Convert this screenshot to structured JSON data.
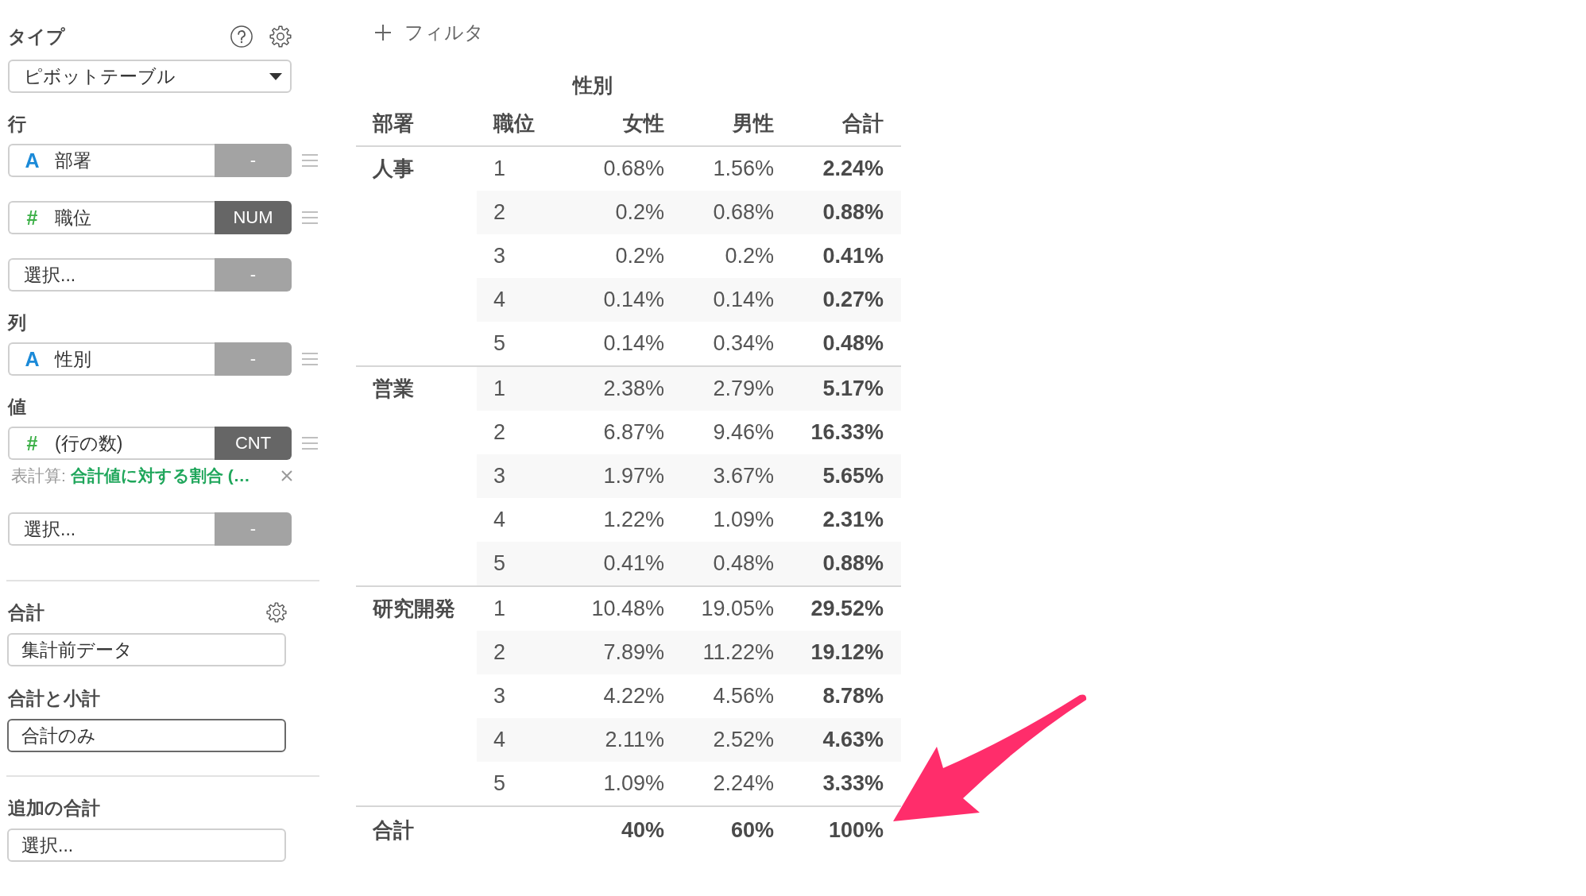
{
  "sidebar": {
    "type": {
      "label": "タイプ",
      "dropdown": {
        "value": "ピボットテーブル"
      }
    },
    "sections": [
      {
        "label": "行",
        "fields": [
          {
            "kind": "string",
            "type_icon": "A",
            "name": "部署",
            "button": {
              "label": "-",
              "active": false
            }
          },
          {
            "kind": "number",
            "type_icon": "#",
            "name": "職位",
            "button": {
              "label": "NUM",
              "active": true
            }
          },
          {
            "kind": "empty",
            "placeholder": "選択...",
            "button": {
              "label": "-",
              "active": false
            }
          }
        ]
      },
      {
        "label": "列",
        "fields": [
          {
            "kind": "string",
            "type_icon": "A",
            "name": "性別",
            "button": {
              "label": "-",
              "active": false
            }
          }
        ]
      },
      {
        "label": "値",
        "fields": [
          {
            "kind": "number",
            "type_icon": "#",
            "name": "(行の数)",
            "button": {
              "label": "CNT",
              "active": true
            },
            "calculation": {
              "label": "表計算:",
              "value": "合計値に対する割合 (…"
            }
          },
          {
            "kind": "empty",
            "placeholder": "選択...",
            "button": {
              "label": "-",
              "active": false
            }
          }
        ]
      }
    ],
    "totals": {
      "label": "合計",
      "dropdown": {
        "value": "集計前データ",
        "focused": false
      }
    },
    "subtotals": {
      "label": "合計と小計",
      "dropdown": {
        "value": "合計のみ",
        "focused": true
      }
    },
    "additional_totals": {
      "label": "追加の合計",
      "dropdown": {
        "placeholder": "選択...",
        "focused": false
      }
    }
  },
  "main": {
    "filter_button": {
      "label": "フィルタ"
    },
    "table": {
      "column_group": "性別",
      "columns": [
        "部署",
        "職位",
        "女性",
        "男性",
        "合計"
      ],
      "groups": [
        {
          "name": "人事",
          "rows": [
            [
              "1",
              "0.68%",
              "1.56%",
              "2.24%"
            ],
            [
              "2",
              "0.2%",
              "0.68%",
              "0.88%"
            ],
            [
              "3",
              "0.2%",
              "0.2%",
              "0.41%"
            ],
            [
              "4",
              "0.14%",
              "0.14%",
              "0.27%"
            ],
            [
              "5",
              "0.14%",
              "0.34%",
              "0.48%"
            ]
          ]
        },
        {
          "name": "営業",
          "rows": [
            [
              "1",
              "2.38%",
              "2.79%",
              "5.17%"
            ],
            [
              "2",
              "6.87%",
              "9.46%",
              "16.33%"
            ],
            [
              "3",
              "1.97%",
              "3.67%",
              "5.65%"
            ],
            [
              "4",
              "1.22%",
              "1.09%",
              "2.31%"
            ],
            [
              "5",
              "0.41%",
              "0.48%",
              "0.88%"
            ]
          ]
        },
        {
          "name": "研究開発",
          "rows": [
            [
              "1",
              "10.48%",
              "19.05%",
              "29.52%"
            ],
            [
              "2",
              "7.89%",
              "11.22%",
              "19.12%"
            ],
            [
              "3",
              "4.22%",
              "4.56%",
              "8.78%"
            ],
            [
              "4",
              "2.11%",
              "2.52%",
              "4.63%"
            ],
            [
              "5",
              "1.09%",
              "2.24%",
              "3.33%"
            ]
          ]
        }
      ],
      "total": {
        "label": "合計",
        "values": [
          "40%",
          "60%",
          "100%"
        ]
      }
    }
  }
}
